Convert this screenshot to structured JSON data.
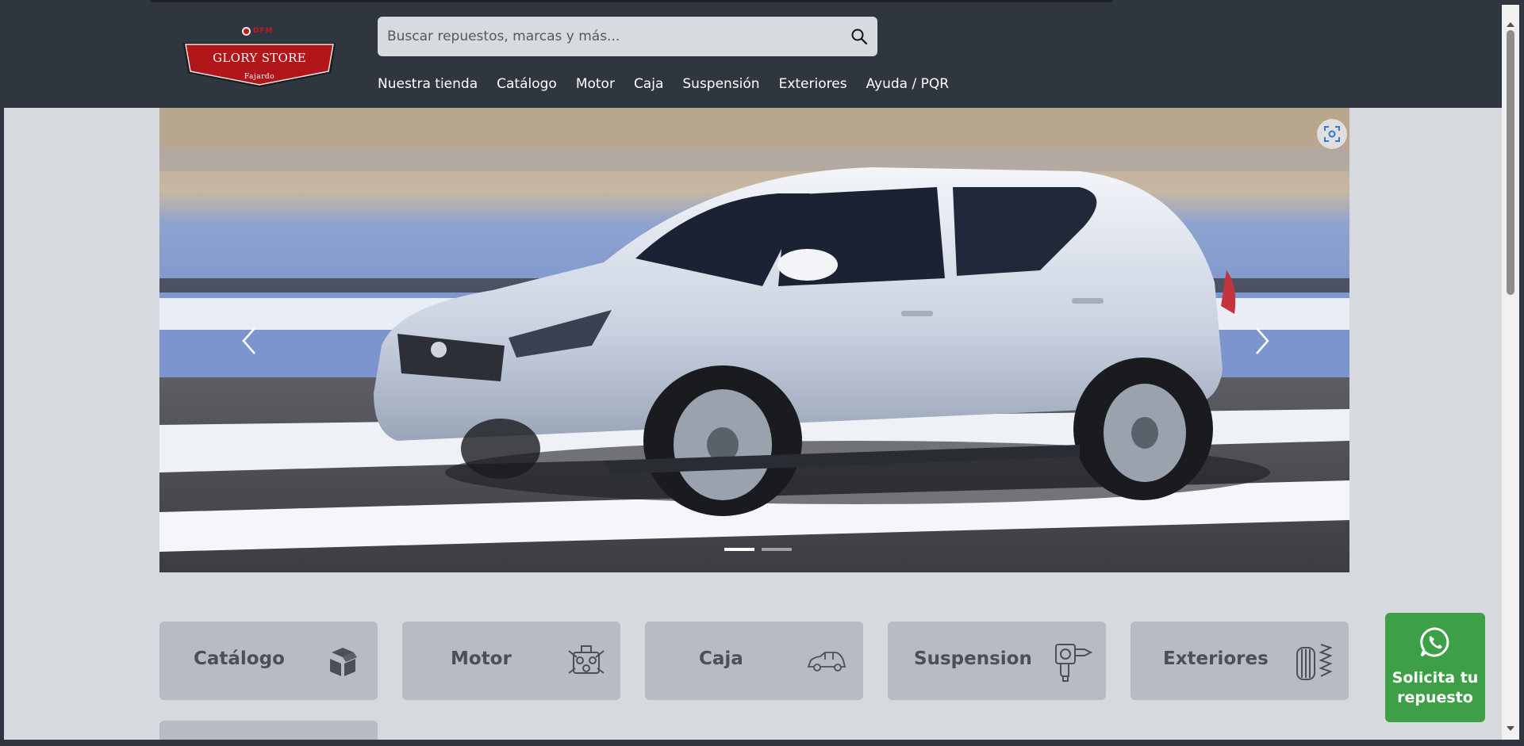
{
  "brand": {
    "logo_top": "DFM",
    "name": "GLORY STORE",
    "subtitle": "Fajardo"
  },
  "search": {
    "placeholder": "Buscar repuestos, marcas y más...",
    "value": ""
  },
  "nav": {
    "items": [
      "Nuestra tienda",
      "Catálogo",
      "Motor",
      "Caja",
      "Suspensión",
      "Exteriores",
      "Ayuda / PQR"
    ]
  },
  "carousel": {
    "slide_count": 2,
    "active_index": 0
  },
  "categories": [
    {
      "label": "Catálogo",
      "icon": "boxes-icon"
    },
    {
      "label": "Motor",
      "icon": "engine-icon"
    },
    {
      "label": "Caja",
      "icon": "car-icon"
    },
    {
      "label": "Suspension",
      "icon": "drill-icon"
    },
    {
      "label": "Exteriores",
      "icon": "tire-icon"
    }
  ],
  "whatsapp": {
    "line1": "Solicita tu",
    "line2": "repuesto",
    "icon": "whatsapp-icon"
  },
  "colors": {
    "header_bg": "#2f3640",
    "page_bg": "#d6d9dd",
    "card_bg": "#b7bbc3",
    "whatsapp_green": "#3ea046",
    "logo_red": "#b0161a"
  }
}
